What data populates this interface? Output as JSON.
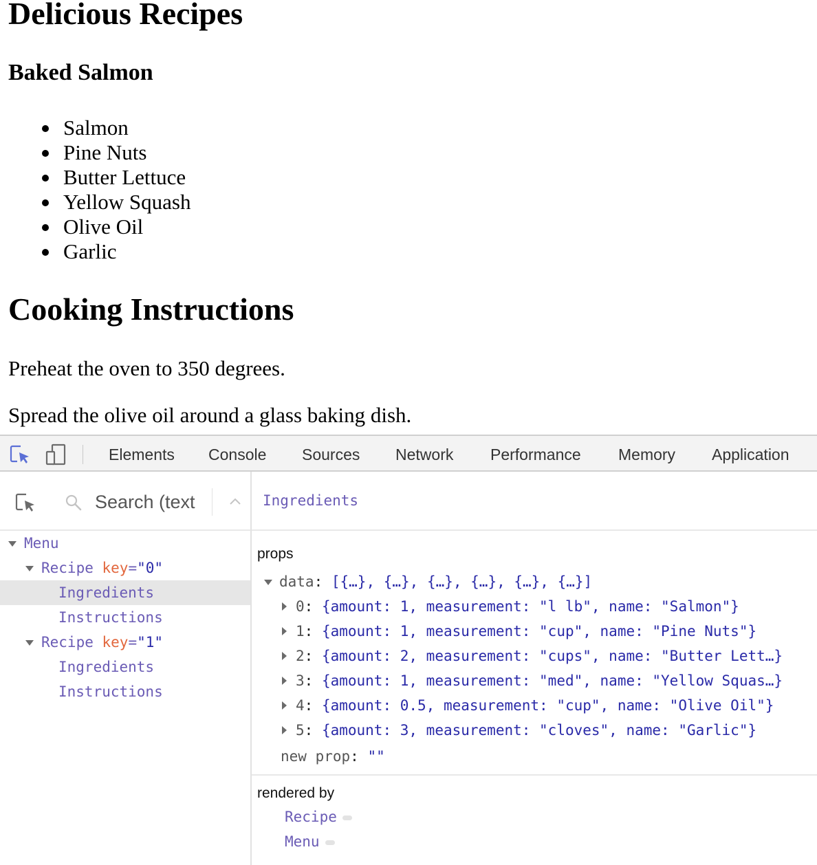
{
  "page": {
    "title": "Delicious Recipes",
    "recipe_name": "Baked Salmon",
    "ingredients": [
      "Salmon",
      "Pine Nuts",
      "Butter Lettuce",
      "Yellow Squash",
      "Olive Oil",
      "Garlic"
    ],
    "instructions_heading": "Cooking Instructions",
    "steps": [
      "Preheat the oven to 350 degrees.",
      "Spread the olive oil around a glass baking dish."
    ]
  },
  "devtools": {
    "tabs": [
      "Elements",
      "Console",
      "Sources",
      "Network",
      "Performance",
      "Memory",
      "Application"
    ],
    "search": {
      "placeholder": "Search (text or /regex/)"
    },
    "tree": [
      {
        "tag": "Menu",
        "key": null,
        "value": null
      },
      {
        "tag": "Recipe",
        "key": "key",
        "value": "\"0\""
      },
      {
        "tag": "Ingredients",
        "key": null,
        "value": null
      },
      {
        "tag": "Instructions",
        "key": null,
        "value": null
      },
      {
        "tag": "Recipe",
        "key": "key",
        "value": "\"1\""
      },
      {
        "tag": "Ingredients",
        "key": null,
        "value": null
      },
      {
        "tag": "Instructions",
        "key": null,
        "value": null
      }
    ],
    "selected_component": "Ingredients",
    "props_label": "props",
    "data_key": "data",
    "data_summary": "[{…}, {…}, {…}, {…}, {…}, {…}]",
    "data_items": [
      {
        "index": "0",
        "value": "{amount: 1, measurement: \"l lb\", name: \"Salmon\"}"
      },
      {
        "index": "1",
        "value": "{amount: 1, measurement: \"cup\", name: \"Pine Nuts\"}"
      },
      {
        "index": "2",
        "value": "{amount: 2, measurement: \"cups\", name: \"Butter Lett…}"
      },
      {
        "index": "3",
        "value": "{amount: 1, measurement: \"med\", name: \"Yellow Squas…}"
      },
      {
        "index": "4",
        "value": "{amount: 0.5, measurement: \"cup\", name: \"Olive Oil\"}"
      },
      {
        "index": "5",
        "value": "{amount: 3, measurement: \"cloves\", name: \"Garlic\"}"
      }
    ],
    "new_prop_label": "new prop",
    "new_prop_value": "\"\"",
    "rendered_by_label": "rendered by",
    "rendered_by": [
      "Recipe",
      "Menu"
    ]
  }
}
